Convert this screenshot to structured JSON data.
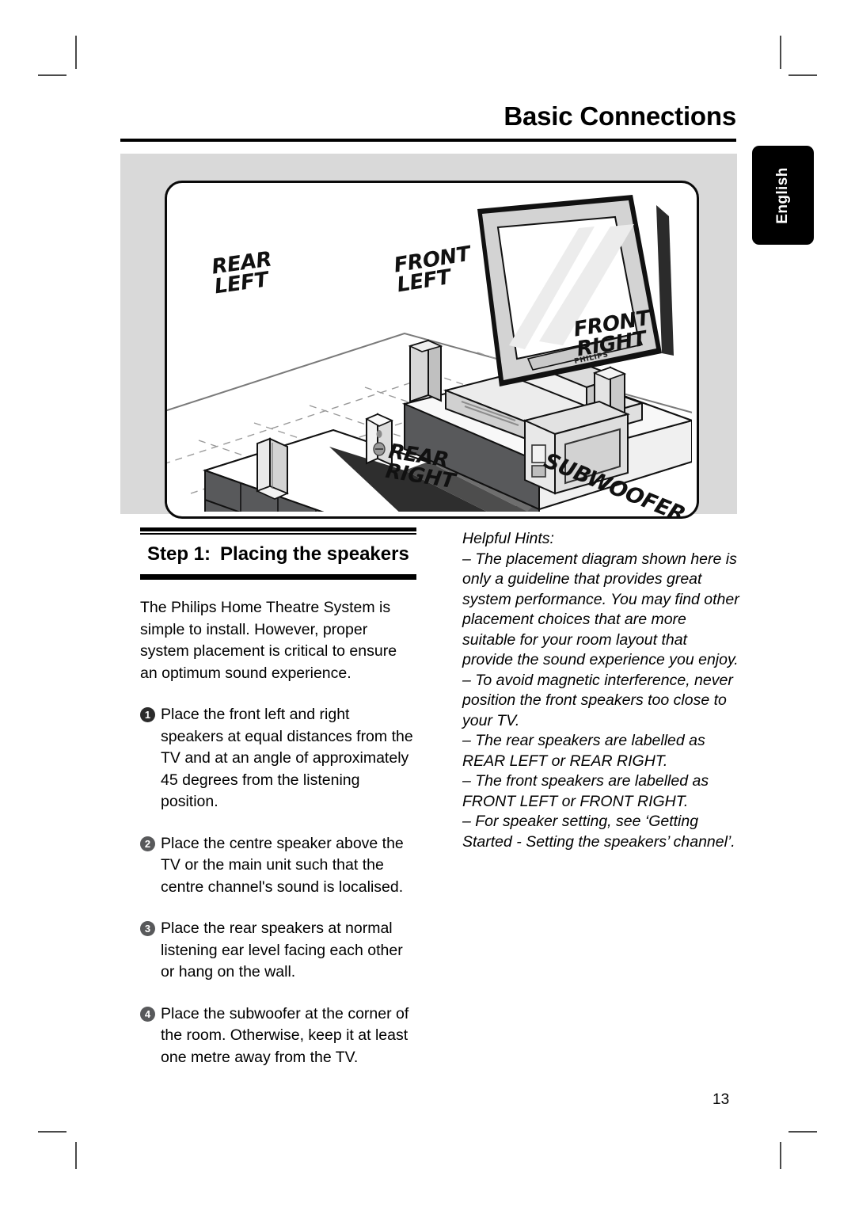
{
  "header": {
    "title": "Basic Connections"
  },
  "language_tab": {
    "label": "English"
  },
  "diagram": {
    "tv_brand": "PHILIPS",
    "labels": {
      "rear_left": "REAR\nLEFT",
      "front_left": "FRONT\nLEFT",
      "front_right": "FRONT\nRIGHT",
      "rear_right": "REAR\nRIGHT",
      "subwoofer": "SUBWOOFER"
    }
  },
  "left_column": {
    "step_label": "Step 1:",
    "step_title": "Placing the speakers",
    "intro": "The Philips Home Theatre System is simple to install. However, proper system placement is critical to ensure an optimum sound experience.",
    "steps": [
      {
        "num": "1",
        "text": "Place the front left and right speakers at equal distances from the TV and at an angle of approximately 45 degrees from the listening position."
      },
      {
        "num": "2",
        "text": "Place the centre speaker above the TV or the main unit such that the centre channel's sound is localised."
      },
      {
        "num": "3",
        "text": "Place the rear speakers at normal listening ear level facing each other or hang on the wall."
      },
      {
        "num": "4",
        "text": "Place the subwoofer at the corner of the room. Otherwise, keep it at least one metre away from the TV."
      }
    ]
  },
  "right_column": {
    "hints_title": "Helpful Hints:",
    "hints": [
      "– The placement diagram shown here is only a guideline that provides great system performance. You may find other placement choices that are more suitable for your room layout that provide the sound experience you enjoy.",
      "– To avoid magnetic interference, never position the front speakers too close to your TV.",
      "– The rear speakers are labelled as REAR LEFT or REAR RIGHT.",
      "– The front speakers are labelled as FRONT LEFT or FRONT RIGHT.",
      "– For speaker setting, see ‘Getting Started - Setting the speakers’ channel’."
    ]
  },
  "footer": {
    "page_number": "13"
  }
}
